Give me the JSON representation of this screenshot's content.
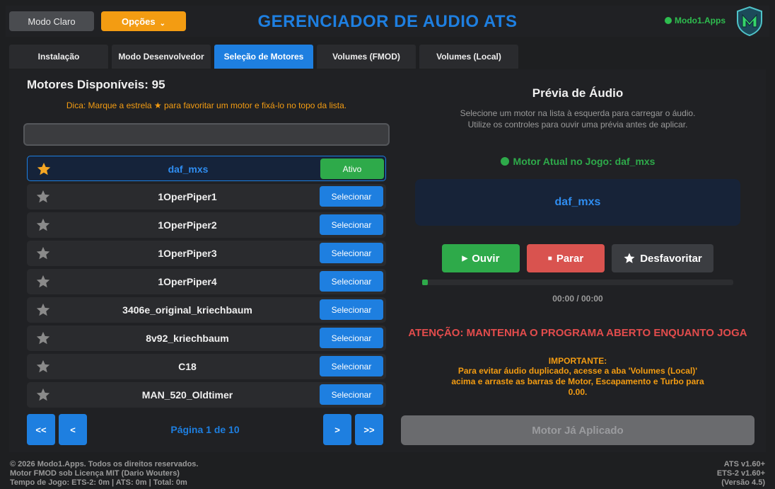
{
  "header": {
    "theme_button": "Modo Claro",
    "options_button": "Opções",
    "options_chevron": "⌄",
    "title": "GERENCIADOR DE AUDIO ATS",
    "brand": "Modo1.Apps",
    "logo_icon": "shield-m-logo"
  },
  "tabs": [
    {
      "label": "Instalação",
      "active": false
    },
    {
      "label": "Modo Desenvolvedor",
      "active": false
    },
    {
      "label": "Seleção de Motores",
      "active": true
    },
    {
      "label": "Volumes (FMOD)",
      "active": false
    },
    {
      "label": "Volumes (Local)",
      "active": false
    }
  ],
  "left": {
    "title": "Motores Disponíveis: 95",
    "tip": "Dica: Marque a estrela ★ para favoritar um motor e fixá-lo no topo da lista.",
    "search": {
      "value": "",
      "placeholder": ""
    },
    "engines": [
      {
        "name": "daf_mxs",
        "favorite": true,
        "button": "Ativo",
        "active": true
      },
      {
        "name": "1OperPiper1",
        "favorite": false,
        "button": "Selecionar",
        "active": false
      },
      {
        "name": "1OperPiper2",
        "favorite": false,
        "button": "Selecionar",
        "active": false
      },
      {
        "name": "1OperPiper3",
        "favorite": false,
        "button": "Selecionar",
        "active": false
      },
      {
        "name": "1OperPiper4",
        "favorite": false,
        "button": "Selecionar",
        "active": false
      },
      {
        "name": "3406e_original_kriechbaum",
        "favorite": false,
        "button": "Selecionar",
        "active": false
      },
      {
        "name": "8v92_kriechbaum",
        "favorite": false,
        "button": "Selecionar",
        "active": false
      },
      {
        "name": "C18",
        "favorite": false,
        "button": "Selecionar",
        "active": false
      },
      {
        "name": "MAN_520_Oldtimer",
        "favorite": false,
        "button": "Selecionar",
        "active": false
      }
    ],
    "pagination": {
      "first": "<<",
      "prev": "<",
      "label": "Página 1 de 10",
      "next": ">",
      "last": ">>"
    }
  },
  "right": {
    "title": "Prévia de Áudio",
    "description": "Selecione um motor na lista à esquerda para carregar o áudio. Utilize os controles para ouvir uma prévia antes de aplicar.",
    "current_engine": "Motor Atual no Jogo: daf_mxs",
    "selected_engine": "daf_mxs",
    "play_button": "Ouvir",
    "stop_button": "Parar",
    "unfavorite_button": "Desfavoritar",
    "progress": 0,
    "time": "00:00 / 00:00",
    "warning": "ATENÇÃO: MANTENHA O PROGRAMA ABERTO ENQUANTO JOGA",
    "important_title": "IMPORTANTE:",
    "important_text": "Para evitar áudio duplicado, acesse a aba 'Volumes (Local)' acima e arraste as barras de Motor, Escapamento e Turbo para 0.00.",
    "apply_button": "Motor Já Aplicado"
  },
  "footer": {
    "copyright": "© 2026 Modo1.Apps. Todos os direitos reservados.",
    "license": "Motor FMOD sob Licença MIT (Dario Wouters)",
    "playtime": "Tempo de Jogo: ETS-2: 0m | ATS: 0m | Total: 0m",
    "ats_version": "ATS v1.60+",
    "ets_version": "ETS-2 v1.60+",
    "app_version": "(Versão 4.5)"
  },
  "colors": {
    "accent": "#1e7fe0",
    "success": "#2eaa4a",
    "danger": "#d9534f",
    "warning": "#f39c12"
  }
}
